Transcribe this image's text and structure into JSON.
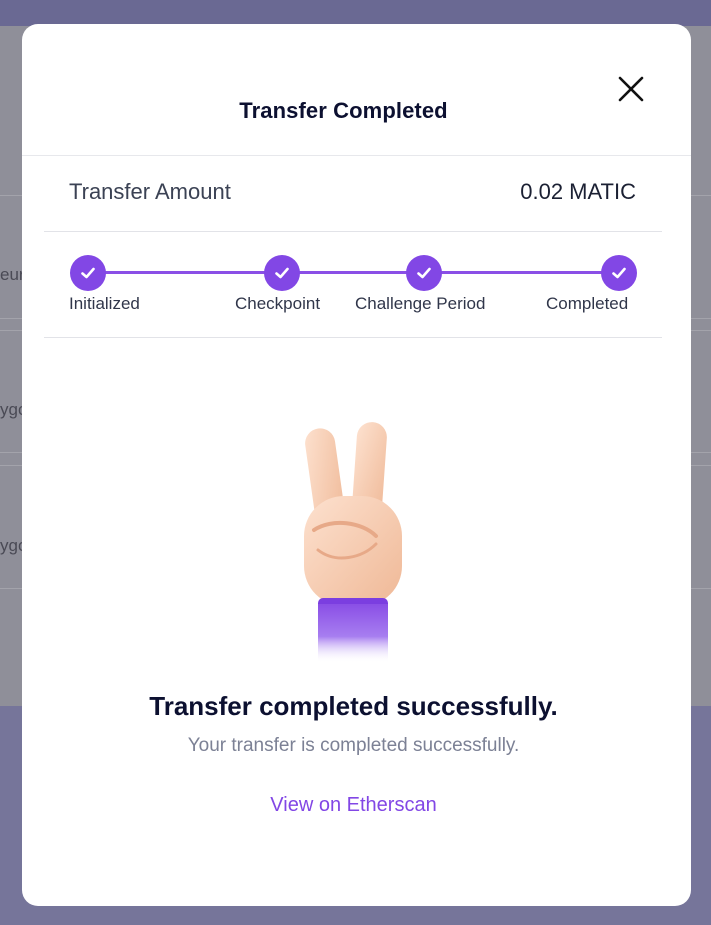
{
  "background": {
    "partial_text_1": "eur",
    "partial_text_2": "ygo",
    "partial_text_3": "ygo"
  },
  "modal": {
    "title": "Transfer Completed",
    "close_icon": "close-icon",
    "transfer_amount_label": "Transfer Amount",
    "transfer_amount_value": "0.02 MATIC",
    "steps": [
      {
        "label": "Initialized",
        "status": "done"
      },
      {
        "label": "Checkpoint",
        "status": "done"
      },
      {
        "label": "Challenge Period",
        "status": "done"
      },
      {
        "label": "Completed",
        "status": "done"
      }
    ],
    "illustration_icon": "victory-hand-icon",
    "success_title": "Transfer completed successfully.",
    "success_subtitle": "Your transfer is completed successfully.",
    "etherscan_link": "View on Etherscan"
  },
  "colors": {
    "accent": "#8247e5",
    "overlay": "#6d6c8f",
    "title_text": "#0c1030"
  }
}
